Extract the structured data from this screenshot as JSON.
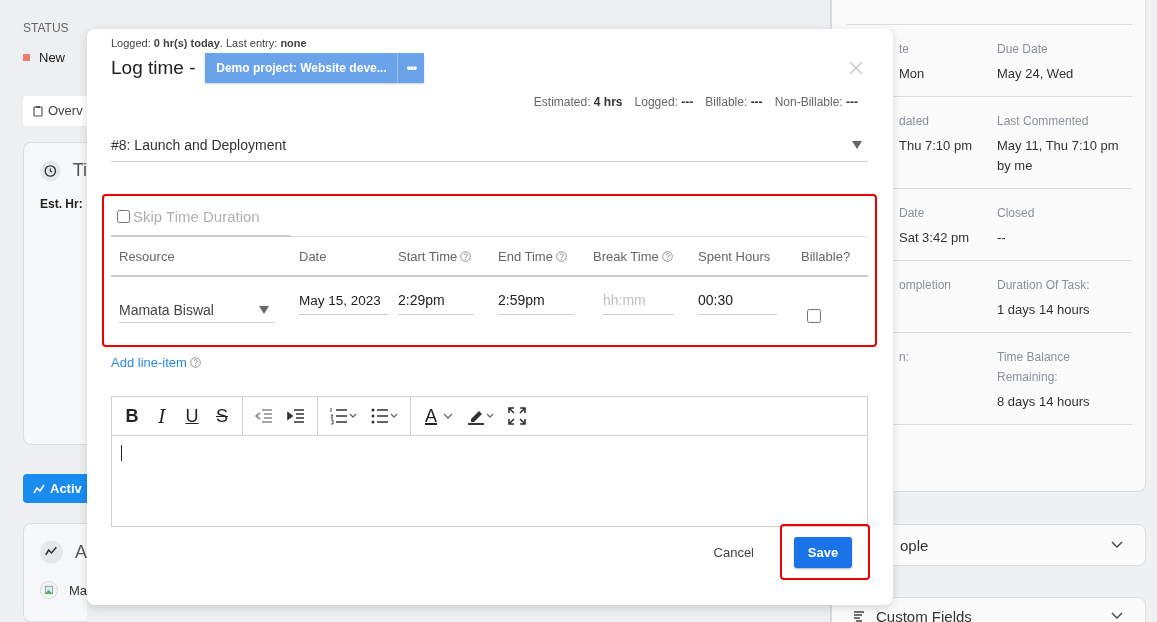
{
  "background": {
    "fields": [
      {
        "label": "STATUS",
        "value": "New"
      }
    ],
    "tab": "Overv",
    "time_card": {
      "title": "Ti",
      "text": "Est. Hr:"
    },
    "activity_button": "Activ",
    "activity_card": {
      "title": "A",
      "entry": "Ma"
    },
    "details": {
      "rows": [
        {
          "left_label": "te",
          "left_value": "Mon",
          "right_label": "Due Date",
          "right_value": "May 24, Wed"
        },
        {
          "left_label": "dated",
          "left_value": "Thu 7:10 pm",
          "right_label": "Last Commented",
          "right_value": "May 11, Thu 7:10 pm by me"
        },
        {
          "left_label": "Date",
          "left_value": "Sat 3:42 pm",
          "right_label": "Closed",
          "right_value": "--"
        },
        {
          "left_label": "ompletion",
          "right_label": "Duration Of Task:",
          "right_value": "1 days 14 hours"
        },
        {
          "left_label": "n:",
          "right_label": "Time Balance Remaining:",
          "right_value": "8 days 14 hours"
        }
      ]
    },
    "accordions": [
      {
        "label": "ople",
        "icon": false
      },
      {
        "label": "Custom Fields",
        "icon": true
      }
    ]
  },
  "modal": {
    "summary": "Logged: **0 hr(s) today**. Last entry: **none**",
    "title": "Log time -",
    "project": "Demo project: Website deve...",
    "project_more": "•••",
    "stats": [
      "Estimated: **4 hrs**",
      "Logged: **---**",
      "Billable: **---**",
      "Non-Billable: **---**"
    ],
    "task": "#8: Launch and Deployment",
    "line_items": {
      "highlighted": true,
      "skip": {
        "label": "Skip Time Duration",
        "checked": false
      },
      "columns": [
        {
          "label": "Resource",
          "help": false
        },
        {
          "label": "Date",
          "help": false
        },
        {
          "label": "Start Time",
          "help": true
        },
        {
          "label": "End Time",
          "help": true
        },
        {
          "label": "Break Time",
          "help": true
        },
        {
          "label": "Spent Hours",
          "help": false
        },
        {
          "label": "Billable?",
          "help": false
        }
      ],
      "rows": [
        {
          "resource": "Mamata Biswal",
          "date": "May 15, 2023",
          "start": "2:29pm",
          "end": "2:59pm",
          "break_placeholder": "hh:mm",
          "spent": "00:30",
          "billable": false
        }
      ]
    },
    "add_line": "Add line-item",
    "toolbar": [
      [
        {
          "kind": "bold",
          "label": "B"
        },
        {
          "kind": "italic",
          "label": "I"
        },
        {
          "kind": "underline",
          "label": "U"
        },
        {
          "kind": "strike",
          "label": "S"
        }
      ],
      [
        {
          "kind": "outdent"
        },
        {
          "kind": "indent"
        }
      ],
      [
        {
          "kind": "ordered"
        },
        {
          "kind": "bullet"
        }
      ],
      [
        {
          "kind": "color",
          "label": "A"
        },
        {
          "kind": "highlight"
        },
        {
          "kind": "fullscreen"
        }
      ]
    ],
    "cancel": "Cancel",
    "save": {
      "label": "Save",
      "highlighted": true
    }
  }
}
